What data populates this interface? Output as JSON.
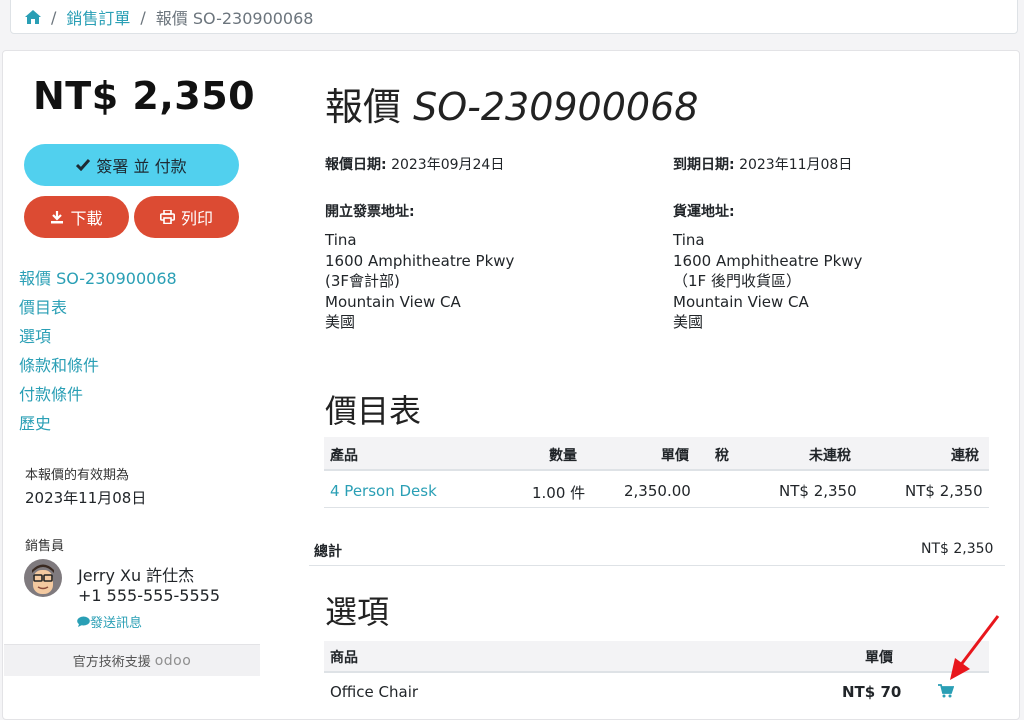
{
  "breadcrumb": {
    "home_icon": "home-icon",
    "parent": "銷售訂單",
    "current": "報價 SO-230900068"
  },
  "sidebar": {
    "amount": "NT$ 2,350",
    "sign_button": "簽署 並 付款",
    "download_button": "下載",
    "print_button": "列印",
    "nav": [
      "報價 SO-230900068",
      "價目表",
      "選項",
      "條款和條件",
      "付款條件",
      "歷史"
    ],
    "validity_label": "本報價的有效期為",
    "validity_date": "2023年11月08日",
    "salesperson_label": "銷售員",
    "rep_name": "Jerry Xu 許仕杰",
    "rep_phone": "+1 555-555-5555",
    "send_message": "發送訊息",
    "support_text": "官方技術支援",
    "support_brand": "odoo"
  },
  "quote": {
    "title_prefix": "報價",
    "title_number": "SO-230900068",
    "quote_date_label": "報價日期:",
    "quote_date": "2023年09月24日",
    "due_date_label": "到期日期:",
    "due_date": "2023年11月08日",
    "invoice_addr_label": "開立發票地址:",
    "invoice_addr": [
      "Tina",
      "1600 Amphitheatre Pkwy",
      "(3F會計部)",
      "Mountain View CA",
      "美國"
    ],
    "ship_addr_label": "貨運地址:",
    "ship_addr": [
      "Tina",
      "1600 Amphitheatre Pkwy",
      "（1F 後門收貨區）",
      "Mountain View CA",
      "美國"
    ]
  },
  "pricelist": {
    "title": "價目表",
    "headers": {
      "product": "產品",
      "qty": "數量",
      "unit_price": "單價",
      "tax": "稅",
      "untaxed": "未連稅",
      "taxed": "連稅"
    },
    "rows": [
      {
        "product": "4 Person Desk",
        "qty": "1.00 件",
        "unit_price": "2,350.00",
        "tax": "",
        "untaxed": "NT$ 2,350",
        "taxed": "NT$ 2,350"
      }
    ],
    "total_label": "總計",
    "total_value": "NT$ 2,350"
  },
  "options": {
    "title": "選項",
    "headers": {
      "product": "商品",
      "unit_price": "單價"
    },
    "rows": [
      {
        "product": "Office Chair",
        "price": "NT$ 70"
      }
    ]
  },
  "colors": {
    "accent": "#2a9fb5",
    "sign": "#51d0ee",
    "danger": "#dc4b33",
    "annotation": "#e8161c"
  }
}
